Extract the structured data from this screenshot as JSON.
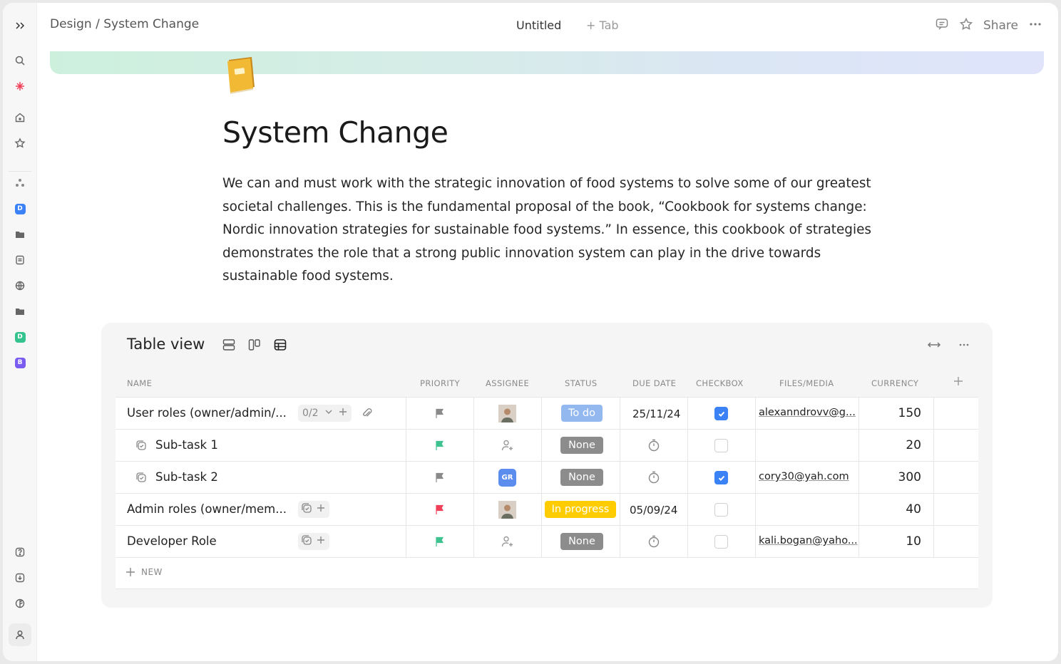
{
  "topbar": {
    "breadcrumb": "Design / System Change",
    "tab_title": "Untitled",
    "add_tab": "+ Tab",
    "share": "Share"
  },
  "page": {
    "title": "System Change",
    "body": "We can and must work with the strategic innovation of food systems to solve some of our greatest societal challenges. This is the fundamental proposal of the book, “Cookbook for systems change: Nordic innovation strategies for sustainable food systems.” In essence, this cookbook of strategies  demonstrates the role that a strong public innovation system can play in the drive towards sustainable food systems."
  },
  "sidebar": {
    "badges": [
      {
        "letter": "D",
        "color": "#3b82f6"
      },
      {
        "letter": "D",
        "color": "#34c38f"
      },
      {
        "letter": "B",
        "color": "#7b5cf0"
      }
    ]
  },
  "table": {
    "title": "Table view",
    "columns": [
      "NAME",
      "PRIORITY",
      "ASSIGNEE",
      "STATUS",
      "DUE DATE",
      "CHECKBOX",
      "FILES/MEDIA",
      "CURRENCY"
    ],
    "new_label": "NEW",
    "rows": [
      {
        "name": "User roles (owner/admin/...",
        "subtasks": "0/2",
        "priority_color": "#8a8a8a",
        "assignee": "photo",
        "status": "To do",
        "status_color": "#93b8f0",
        "due": "25/11/24",
        "checked": true,
        "file": "alexanndrovv@g...",
        "currency": "150"
      },
      {
        "name": "Sub-task 1",
        "priority_color": "#3ec28f",
        "assignee": "empty",
        "status": "None",
        "status_color": "#8c8c8c",
        "due": "",
        "checked": false,
        "file": "",
        "currency": "20"
      },
      {
        "name": "Sub-task 2",
        "priority_color": "#8a8a8a",
        "assignee": "GR",
        "status": "None",
        "status_color": "#8c8c8c",
        "due": "",
        "checked": true,
        "file": "cory30@yah.com",
        "currency": "300"
      },
      {
        "name": "Admin roles (owner/mem...",
        "priority_color": "#f0405a",
        "assignee": "photo",
        "status": "In progress",
        "status_color": "#ffcc00",
        "due": "05/09/24",
        "checked": false,
        "file": "",
        "currency": "40"
      },
      {
        "name": "Developer Role",
        "priority_color": "#3ec28f",
        "assignee": "empty",
        "status": "None",
        "status_color": "#8c8c8c",
        "due": "",
        "checked": false,
        "file": "kali.bogan@yaho...",
        "currency": "10"
      }
    ]
  }
}
